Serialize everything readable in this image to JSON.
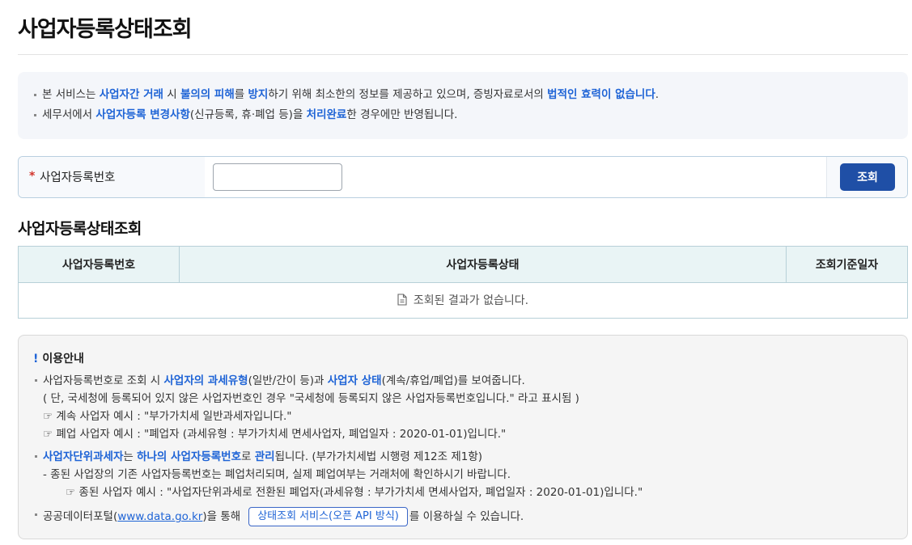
{
  "header": {
    "title": "사업자등록상태조회"
  },
  "notice": {
    "line1": [
      {
        "t": "본 서비스는 ",
        "hl": false
      },
      {
        "t": "사업자간 거래",
        "hl": true
      },
      {
        "t": " 시 ",
        "hl": false
      },
      {
        "t": "불의의 피해",
        "hl": true
      },
      {
        "t": "를 ",
        "hl": false
      },
      {
        "t": "방지",
        "hl": true
      },
      {
        "t": "하기 위해 최소한의 정보를 제공하고 있으며, 증빙자료로서의 ",
        "hl": false
      },
      {
        "t": "법적인 효력이 없습니다",
        "hl": true
      },
      {
        "t": ".",
        "hl": false
      }
    ],
    "line2": [
      {
        "t": "세무서에서 ",
        "hl": false
      },
      {
        "t": "사업자등록 변경사항",
        "hl": true
      },
      {
        "t": "(신규등록, 휴·폐업 등)을 ",
        "hl": false
      },
      {
        "t": "처리완료",
        "hl": true
      },
      {
        "t": "한 경우에만 반영됩니다.",
        "hl": false
      }
    ]
  },
  "search": {
    "required_mark": "*",
    "label": "사업자등록번호",
    "input_value": "",
    "button_label": "조회"
  },
  "results": {
    "section_title": "사업자등록상태조회",
    "columns": [
      "사업자등록번호",
      "사업자등록상태",
      "조회기준일자"
    ],
    "empty_message": "조회된 결과가 없습니다.",
    "empty_icon": "document-icon"
  },
  "guide": {
    "mark": "!",
    "title": "이용안내",
    "b1": [
      {
        "t": "사업자등록번호로 조회 시 ",
        "hl": false
      },
      {
        "t": "사업자의 과세유형",
        "hl": true
      },
      {
        "t": "(일반/간이 등)과 ",
        "hl": false
      },
      {
        "t": "사업자 상태",
        "hl": true
      },
      {
        "t": "(계속/휴업/폐업)를 보여줍니다.",
        "hl": false
      }
    ],
    "b1_sub1": "( 단, 국세청에 등록되어 있지 않은 사업자번호인 경우 \"국세청에 등록되지 않은 사업자등록번호입니다.\" 라고 표시됨 )",
    "b1_sub2": "☞ 계속 사업자 예시 : \"부가가치세 일반과세자입니다.\"",
    "b1_sub3": "☞ 폐업 사업자 예시 : \"폐업자 (과세유형 : 부가가치세 면세사업자, 폐업일자 : 2020-01-01)입니다.\"",
    "b2": [
      {
        "t": "사업자단위과세자",
        "hl": true
      },
      {
        "t": "는 ",
        "hl": false
      },
      {
        "t": "하나의 사업자등록번호",
        "hl": true
      },
      {
        "t": "로 ",
        "hl": false
      },
      {
        "t": "관리",
        "hl": true
      },
      {
        "t": "됩니다. (부가가치세법 시행령 제12조 제1항)",
        "hl": false
      }
    ],
    "b2_sub1": "- 종된 사업장의 기존 사업자등록번호는 폐업처리되며, 실제 폐업여부는 거래처에 확인하시기 바랍니다.",
    "b2_sub2": "☞ 종된 사업자 예시 : \"사업자단위과세로 전환된 폐업자(과세유형 : 부가가치세 면세사업자, 폐업일자 : 2020-01-01)입니다.\"",
    "b3_prefix": "공공데이터포털(",
    "b3_link": "www.data.go.kr",
    "b3_mid": ")을 통해",
    "b3_button": "상태조회 서비스(오픈 API 방식)",
    "b3_suffix": "를 이용하실 수 있습니다."
  },
  "colors": {
    "accent": "#1f64d6",
    "button": "#1f4fa6",
    "required": "#d2342c",
    "table_header_bg": "#e9f4f5"
  }
}
